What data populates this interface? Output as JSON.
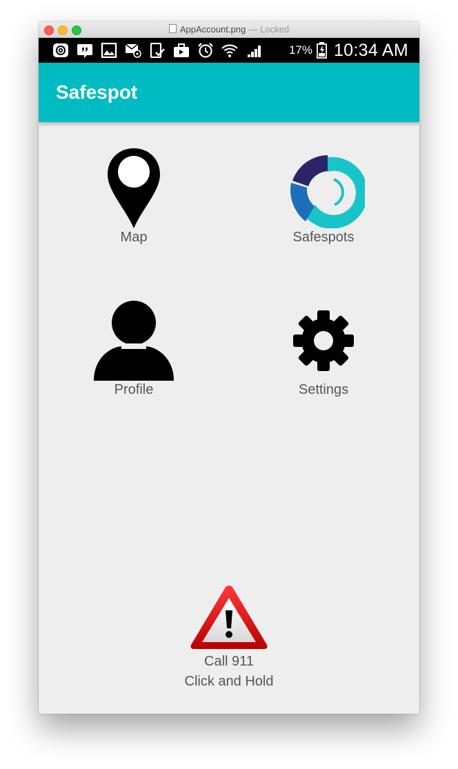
{
  "window": {
    "filename": "AppAccount.png",
    "separator": "—",
    "status": "Locked"
  },
  "statusbar": {
    "icons": [
      "email-icon",
      "hangouts-icon",
      "gallery-icon",
      "mail-at-icon",
      "tablet-check-icon",
      "briefcase-icon",
      "alarm-icon",
      "wifi-icon",
      "signal-icon",
      "battery-icon"
    ],
    "battery": "17%",
    "time": "10:34 AM"
  },
  "appbar": {
    "title": "Safespot"
  },
  "tiles": [
    {
      "label": "Map",
      "icon": "map-pin-icon"
    },
    {
      "label": "Safespots",
      "icon": "safespots-logo-icon"
    },
    {
      "label": "Profile",
      "icon": "person-icon"
    },
    {
      "label": "Settings",
      "icon": "gear-icon"
    }
  ],
  "emergency": {
    "icon": "warning-icon",
    "line1": "Call 911",
    "line2": "Click and Hold"
  },
  "colors": {
    "appbar": "#00bcc2",
    "background": "#eeeeee",
    "warning": "#e01818",
    "safespots_teal": "#18c4c8",
    "safespots_navy": "#2a2468",
    "safespots_blue": "#1c6fb8"
  }
}
